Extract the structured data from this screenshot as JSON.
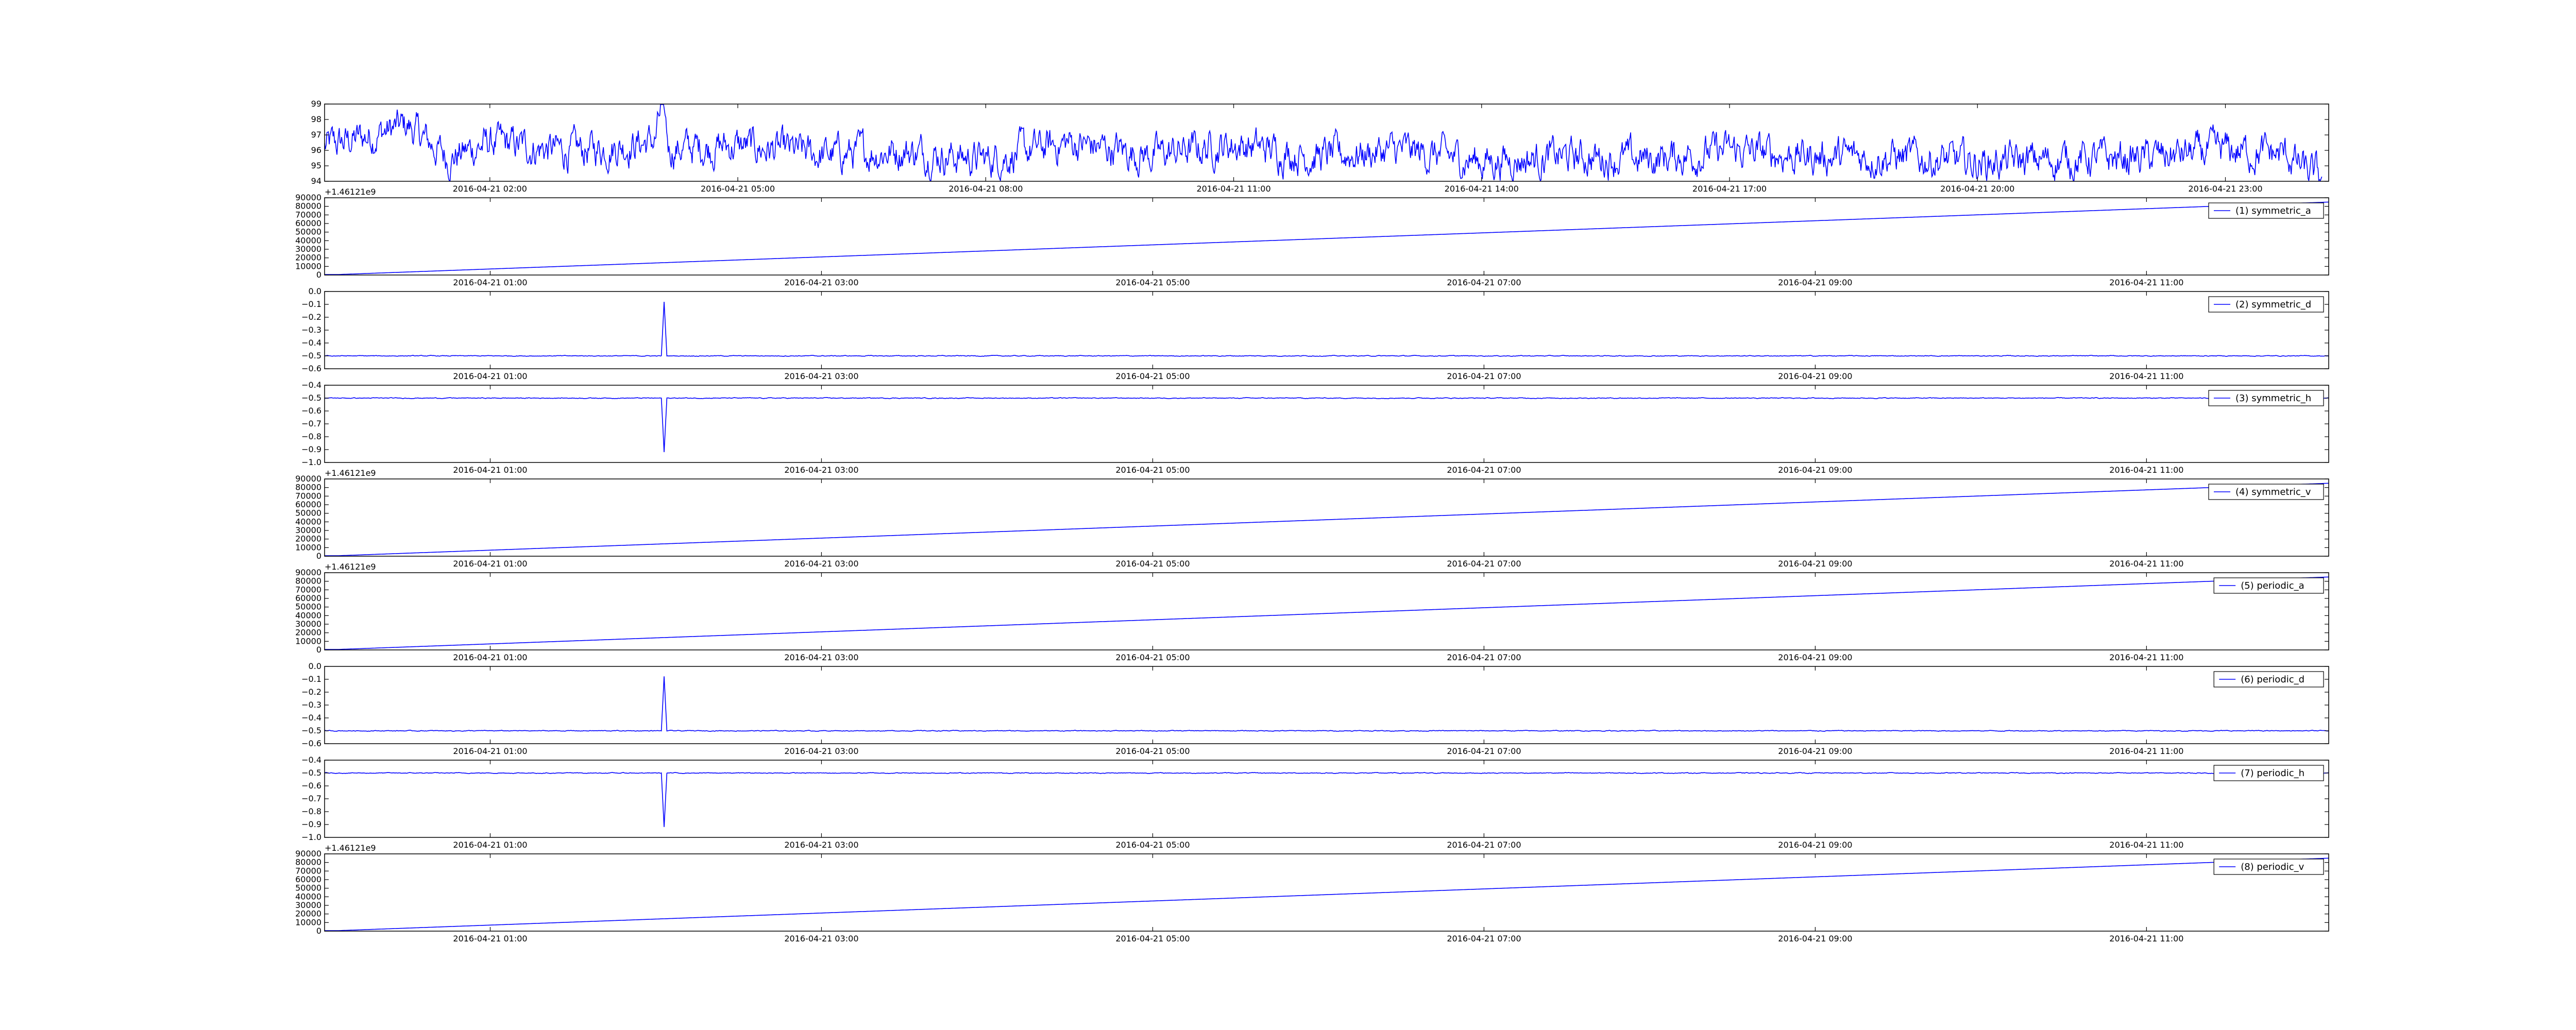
{
  "chart_data": [
    {
      "type": "line",
      "y_ticks": [
        "94",
        "95",
        "96",
        "97",
        "98",
        "99"
      ],
      "ylim": [
        94,
        99
      ],
      "x_tick_labels": [
        "2016-04-21 02:00",
        "2016-04-21 05:00",
        "2016-04-21 08:00",
        "2016-04-21 11:00",
        "2016-04-21 14:00",
        "2016-04-21 17:00",
        "2016-04-21 20:00",
        "2016-04-21 23:00"
      ],
      "xlim": [
        "2016-04-21 00:00",
        "2016-04-22 00:15"
      ],
      "y_offset_label": "",
      "legend": "",
      "series": [
        {
          "x": [
            "2016-04-21 00:00",
            "2016-04-21 01:00",
            "2016-04-21 01:30",
            "2016-04-21 02:00",
            "2016-04-21 03:00",
            "2016-04-21 04:00",
            "2016-04-21 04:05",
            "2016-04-21 04:10",
            "2016-04-21 05:00",
            "2016-04-21 06:00",
            "2016-04-21 07:00",
            "2016-04-21 08:00",
            "2016-04-21 09:00",
            "2016-04-21 10:00",
            "2016-04-21 11:00",
            "2016-04-21 12:00",
            "2016-04-21 13:00",
            "2016-04-21 14:00",
            "2016-04-21 15:00",
            "2016-04-21 16:00",
            "2016-04-21 17:00",
            "2016-04-21 18:00",
            "2016-04-21 19:00",
            "2016-04-21 20:00",
            "2016-04-21 21:00",
            "2016-04-21 22:00",
            "2016-04-21 23:00",
            "2016-04-21 23:45",
            "2016-04-22 00:00",
            "2016-04-22 00:10"
          ],
          "values": [
            96.2,
            97.6,
            95.5,
            96.5,
            95.9,
            96.6,
            98.9,
            96.1,
            96.3,
            95.7,
            96.0,
            95.4,
            96.5,
            95.7,
            96.4,
            95.6,
            96.0,
            95.3,
            95.6,
            95.4,
            96.0,
            95.6,
            95.6,
            95.2,
            95.4,
            95.5,
            96.0,
            95.7,
            94.5,
            94.3
          ],
          "noise": 0.55
        }
      ]
    },
    {
      "type": "line",
      "y_ticks": [
        "0",
        "10000",
        "20000",
        "30000",
        "40000",
        "50000",
        "60000",
        "70000",
        "80000",
        "90000"
      ],
      "ylim": [
        0,
        90000
      ],
      "x_tick_labels": [
        "2016-04-21 01:00",
        "2016-04-21 03:00",
        "2016-04-21 05:00",
        "2016-04-21 07:00",
        "2016-04-21 09:00",
        "2016-04-21 11:00"
      ],
      "xlim": [
        "2016-04-21 00:00",
        "2016-04-21 12:06"
      ],
      "y_offset_label": "+1.46121e9",
      "legend": "(1) symmetric_a",
      "series": [
        {
          "x": [
            "2016-04-21 00:00",
            "2016-04-21 12:06"
          ],
          "values": [
            0,
            85000
          ],
          "noise": 0
        }
      ]
    },
    {
      "type": "line",
      "y_ticks": [
        "−0.6",
        "−0.5",
        "−0.4",
        "−0.3",
        "−0.2",
        "−0.1",
        "0.0"
      ],
      "ylim": [
        -0.6,
        0.0
      ],
      "x_tick_labels": [
        "2016-04-21 01:00",
        "2016-04-21 03:00",
        "2016-04-21 05:00",
        "2016-04-21 07:00",
        "2016-04-21 09:00",
        "2016-04-21 11:00"
      ],
      "xlim": [
        "2016-04-21 00:00",
        "2016-04-21 12:06"
      ],
      "y_offset_label": "",
      "legend": "(2) symmetric_d",
      "series": [
        {
          "x": [
            "2016-04-21 00:00",
            "2016-04-21 02:02",
            "2016-04-21 02:03",
            "2016-04-21 02:04",
            "2016-04-21 12:06"
          ],
          "values": [
            -0.5,
            -0.5,
            -0.08,
            -0.5,
            -0.5
          ],
          "noise": 0.012
        }
      ]
    },
    {
      "type": "line",
      "y_ticks": [
        "−1.0",
        "−0.9",
        "−0.8",
        "−0.7",
        "−0.6",
        "−0.5",
        "−0.4"
      ],
      "ylim": [
        -1.0,
        -0.4
      ],
      "x_tick_labels": [
        "2016-04-21 01:00",
        "2016-04-21 03:00",
        "2016-04-21 05:00",
        "2016-04-21 07:00",
        "2016-04-21 09:00",
        "2016-04-21 11:00"
      ],
      "xlim": [
        "2016-04-21 00:00",
        "2016-04-21 12:06"
      ],
      "y_offset_label": "",
      "legend": "(3) symmetric_h",
      "series": [
        {
          "x": [
            "2016-04-21 00:00",
            "2016-04-21 02:02",
            "2016-04-21 02:03",
            "2016-04-21 02:04",
            "2016-04-21 12:06"
          ],
          "values": [
            -0.5,
            -0.5,
            -0.92,
            -0.5,
            -0.5
          ],
          "noise": 0.012
        }
      ]
    },
    {
      "type": "line",
      "y_ticks": [
        "0",
        "10000",
        "20000",
        "30000",
        "40000",
        "50000",
        "60000",
        "70000",
        "80000",
        "90000"
      ],
      "ylim": [
        0,
        90000
      ],
      "x_tick_labels": [
        "2016-04-21 01:00",
        "2016-04-21 03:00",
        "2016-04-21 05:00",
        "2016-04-21 07:00",
        "2016-04-21 09:00",
        "2016-04-21 11:00"
      ],
      "xlim": [
        "2016-04-21 00:00",
        "2016-04-21 12:06"
      ],
      "y_offset_label": "+1.46121e9",
      "legend": "(4) symmetric_v",
      "series": [
        {
          "x": [
            "2016-04-21 00:00",
            "2016-04-21 12:06"
          ],
          "values": [
            0,
            85000
          ],
          "noise": 0
        }
      ]
    },
    {
      "type": "line",
      "y_ticks": [
        "0",
        "10000",
        "20000",
        "30000",
        "40000",
        "50000",
        "60000",
        "70000",
        "80000",
        "90000"
      ],
      "ylim": [
        0,
        90000
      ],
      "x_tick_labels": [
        "2016-04-21 01:00",
        "2016-04-21 03:00",
        "2016-04-21 05:00",
        "2016-04-21 07:00",
        "2016-04-21 09:00",
        "2016-04-21 11:00"
      ],
      "xlim": [
        "2016-04-21 00:00",
        "2016-04-21 12:06"
      ],
      "y_offset_label": "+1.46121e9",
      "legend": "(5) periodic_a",
      "series": [
        {
          "x": [
            "2016-04-21 00:00",
            "2016-04-21 12:06"
          ],
          "values": [
            0,
            85000
          ],
          "noise": 0
        }
      ]
    },
    {
      "type": "line",
      "y_ticks": [
        "−0.6",
        "−0.5",
        "−0.4",
        "−0.3",
        "−0.2",
        "−0.1",
        "0.0"
      ],
      "ylim": [
        -0.6,
        0.0
      ],
      "x_tick_labels": [
        "2016-04-21 01:00",
        "2016-04-21 03:00",
        "2016-04-21 05:00",
        "2016-04-21 07:00",
        "2016-04-21 09:00",
        "2016-04-21 11:00"
      ],
      "xlim": [
        "2016-04-21 00:00",
        "2016-04-21 12:06"
      ],
      "y_offset_label": "",
      "legend": "(6) periodic_d",
      "series": [
        {
          "x": [
            "2016-04-21 00:00",
            "2016-04-21 02:02",
            "2016-04-21 02:03",
            "2016-04-21 02:04",
            "2016-04-21 12:06"
          ],
          "values": [
            -0.5,
            -0.5,
            -0.08,
            -0.5,
            -0.5
          ],
          "noise": 0.012
        }
      ]
    },
    {
      "type": "line",
      "y_ticks": [
        "−1.0",
        "−0.9",
        "−0.8",
        "−0.7",
        "−0.6",
        "−0.5",
        "−0.4"
      ],
      "ylim": [
        -1.0,
        -0.4
      ],
      "x_tick_labels": [
        "2016-04-21 01:00",
        "2016-04-21 03:00",
        "2016-04-21 05:00",
        "2016-04-21 07:00",
        "2016-04-21 09:00",
        "2016-04-21 11:00"
      ],
      "xlim": [
        "2016-04-21 00:00",
        "2016-04-21 12:06"
      ],
      "y_offset_label": "",
      "legend": "(7) periodic_h",
      "series": [
        {
          "x": [
            "2016-04-21 00:00",
            "2016-04-21 02:02",
            "2016-04-21 02:03",
            "2016-04-21 02:04",
            "2016-04-21 12:06"
          ],
          "values": [
            -0.5,
            -0.5,
            -0.92,
            -0.5,
            -0.5
          ],
          "noise": 0.012
        }
      ]
    },
    {
      "type": "line",
      "y_ticks": [
        "0",
        "10000",
        "20000",
        "30000",
        "40000",
        "50000",
        "60000",
        "70000",
        "80000",
        "90000"
      ],
      "ylim": [
        0,
        90000
      ],
      "x_tick_labels": [
        "2016-04-21 01:00",
        "2016-04-21 03:00",
        "2016-04-21 05:00",
        "2016-04-21 07:00",
        "2016-04-21 09:00",
        "2016-04-21 11:00"
      ],
      "xlim": [
        "2016-04-21 00:00",
        "2016-04-21 12:06"
      ],
      "y_offset_label": "+1.46121e9",
      "legend": "(8) periodic_v",
      "series": [
        {
          "x": [
            "2016-04-21 00:00",
            "2016-04-21 12:06"
          ],
          "values": [
            0,
            85000
          ],
          "noise": 0
        }
      ]
    }
  ],
  "style": {
    "line_color": "#0000ff",
    "axes_color": "#000000",
    "background": "#ffffff"
  }
}
